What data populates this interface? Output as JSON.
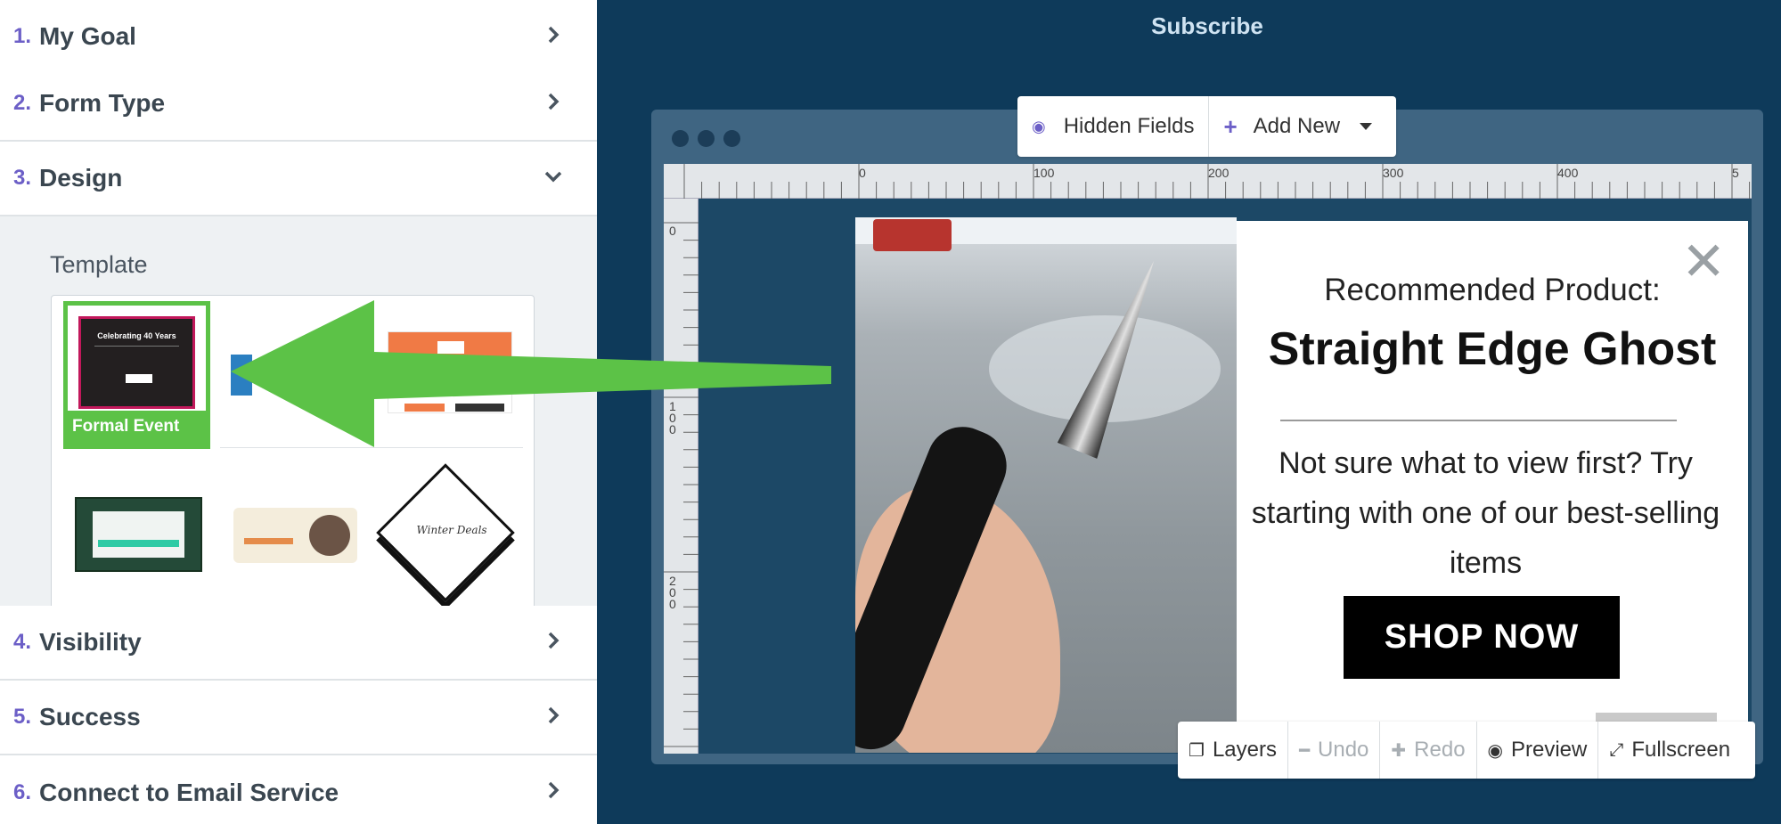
{
  "sidebar": {
    "steps": [
      {
        "num": "1.",
        "label": "My Goal"
      },
      {
        "num": "2.",
        "label": "Form Type"
      },
      {
        "num": "3.",
        "label": "Design"
      },
      {
        "num": "4.",
        "label": "Visibility"
      },
      {
        "num": "5.",
        "label": "Success"
      },
      {
        "num": "6.",
        "label": "Connect to Email Service"
      }
    ],
    "design": {
      "section_title": "Template",
      "selected_template": "Formal Event",
      "selected_thumb_heading": "Celebrating 40 Years",
      "winter_thumb_text": "Winter Deals"
    }
  },
  "main": {
    "title": "Subscribe",
    "toolbar_top": {
      "hidden_fields": "Hidden Fields",
      "add_new": "Add New"
    },
    "ruler": {
      "top_marks": [
        "0",
        "100",
        "200",
        "300",
        "400",
        "5"
      ],
      "left_marks": [
        "0",
        "100",
        "200"
      ]
    },
    "popup": {
      "subtitle": "Recommended Product:",
      "title": "Straight Edge Ghost",
      "body": "Not sure what to view first?  Try starting with one of our best-selling items",
      "cta": "SHOP NOW",
      "close_glyph": "✕"
    },
    "toolbar_bottom": {
      "layers": "Layers",
      "undo": "Undo",
      "redo": "Redo",
      "preview": "Preview",
      "fullscreen": "Fullscreen"
    }
  },
  "colors": {
    "accent": "#6c5fc7",
    "selection_green": "#5cc247",
    "canvas_bg": "#0e3a5a"
  }
}
